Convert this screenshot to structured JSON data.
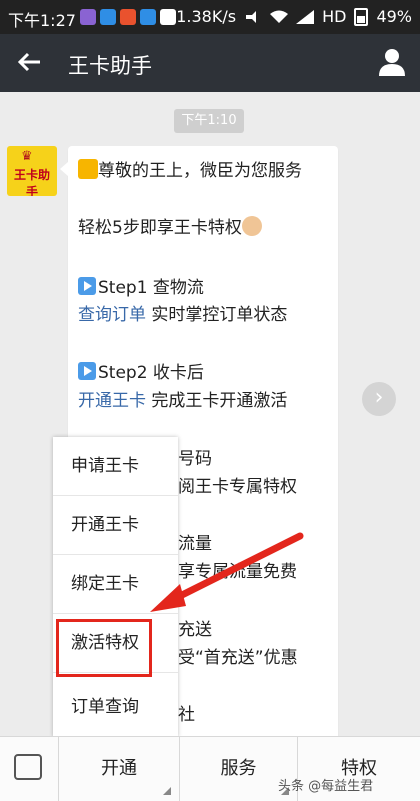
{
  "status_bar": {
    "time": "下午1:27",
    "network_speed": "1.38K/s",
    "network_type": "HD",
    "battery": "49%"
  },
  "header": {
    "title": "王卡助手",
    "back_icon": "arrow-left-icon",
    "profile_icon": "person-icon"
  },
  "chat": {
    "timestamp": "下午1:10",
    "avatar_text": "王卡助手",
    "lines": [
      {
        "text": "尊敬的王上，微臣为您服务"
      },
      {
        "text": "轻松5步即享王卡特权"
      },
      {
        "text": "Step1 查物流"
      },
      {
        "link": "查询订单",
        "text": " 实时掌控订单状态"
      },
      {
        "text": "Step2 收卡后"
      },
      {
        "link": "开通王卡",
        "text": " 完成王卡开通激活"
      },
      {
        "text": "号码"
      },
      {
        "text": "阅王卡专属特权"
      },
      {
        "text": "流量"
      },
      {
        "text": "享专属流量免费"
      },
      {
        "text": "充送"
      },
      {
        "text": "受“首充送”优惠"
      },
      {
        "text": "社"
      }
    ]
  },
  "popup_menu": {
    "items": [
      "申请王卡",
      "开通王卡",
      "绑定王卡",
      "激活特权",
      "订单查询"
    ],
    "highlighted": "激活特权"
  },
  "bottom_bar": {
    "keyboard_icon": "keyboard-icon",
    "tabs": [
      "开通",
      "服务",
      "特权"
    ]
  },
  "watermark": "头条 @每益生君",
  "colors": {
    "status_bar": "#222222",
    "title_bar": "#2e3238",
    "link": "#3868a8",
    "highlight": "#e3261c"
  }
}
